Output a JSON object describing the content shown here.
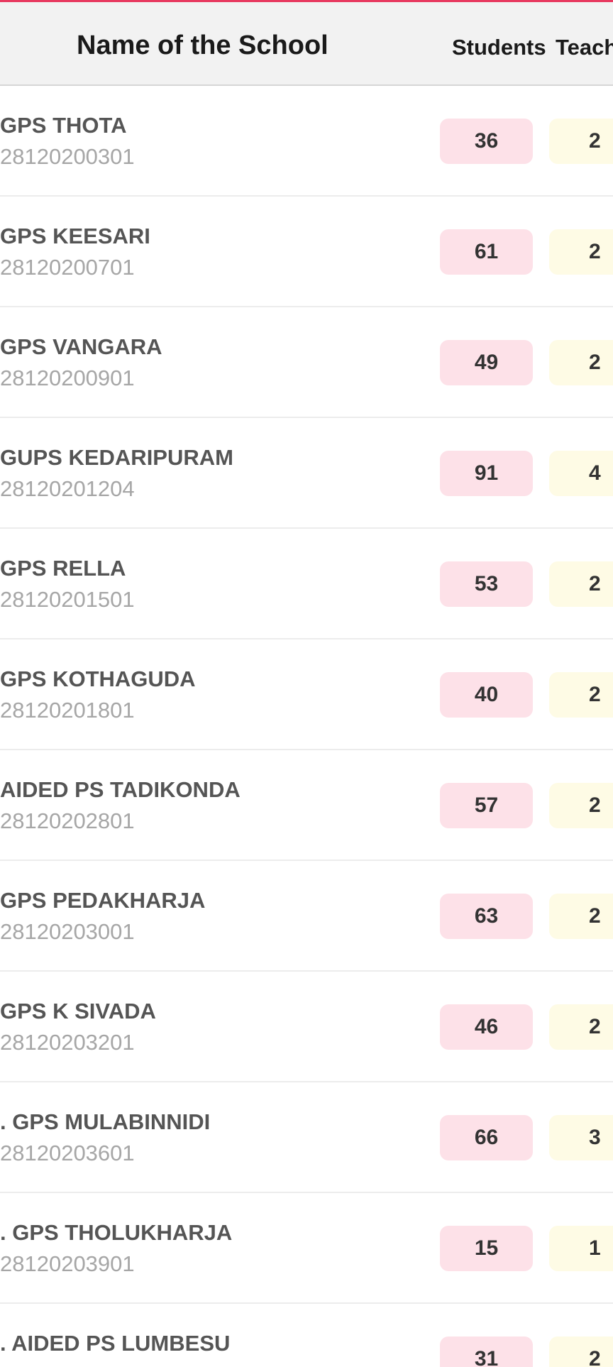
{
  "header": {
    "name_label": "Name of the School",
    "students_label": "Students",
    "teachers_label": "Teach"
  },
  "schools": [
    {
      "name": "GPS THOTA",
      "code": "28120200301",
      "students": "36",
      "teachers": "2"
    },
    {
      "name": "GPS KEESARI",
      "code": "28120200701",
      "students": "61",
      "teachers": "2"
    },
    {
      "name": "GPS VANGARA",
      "code": "28120200901",
      "students": "49",
      "teachers": "2"
    },
    {
      "name": "GUPS KEDARIPURAM",
      "code": "28120201204",
      "students": "91",
      "teachers": "4"
    },
    {
      "name": "GPS RELLA",
      "code": "28120201501",
      "students": "53",
      "teachers": "2"
    },
    {
      "name": "GPS KOTHAGUDA",
      "code": "28120201801",
      "students": "40",
      "teachers": "2"
    },
    {
      "name": "AIDED PS TADIKONDA",
      "code": "28120202801",
      "students": "57",
      "teachers": "2"
    },
    {
      "name": "GPS PEDAKHARJA",
      "code": "28120203001",
      "students": "63",
      "teachers": "2"
    },
    {
      "name": "GPS K SIVADA",
      "code": "28120203201",
      "students": "46",
      "teachers": "2"
    },
    {
      "name": ". GPS MULABINNIDI",
      "code": "28120203601",
      "students": "66",
      "teachers": "3"
    },
    {
      "name": ". GPS THOLUKHARJA",
      "code": "28120203901",
      "students": "15",
      "teachers": "1"
    },
    {
      "name": ". AIDED PS LUMBESU",
      "code": "",
      "students": "31",
      "teachers": "2"
    }
  ],
  "colors": {
    "accent": "#e8395f",
    "students_badge": "#fde1e8",
    "teachers_badge": "#fefbe5"
  }
}
